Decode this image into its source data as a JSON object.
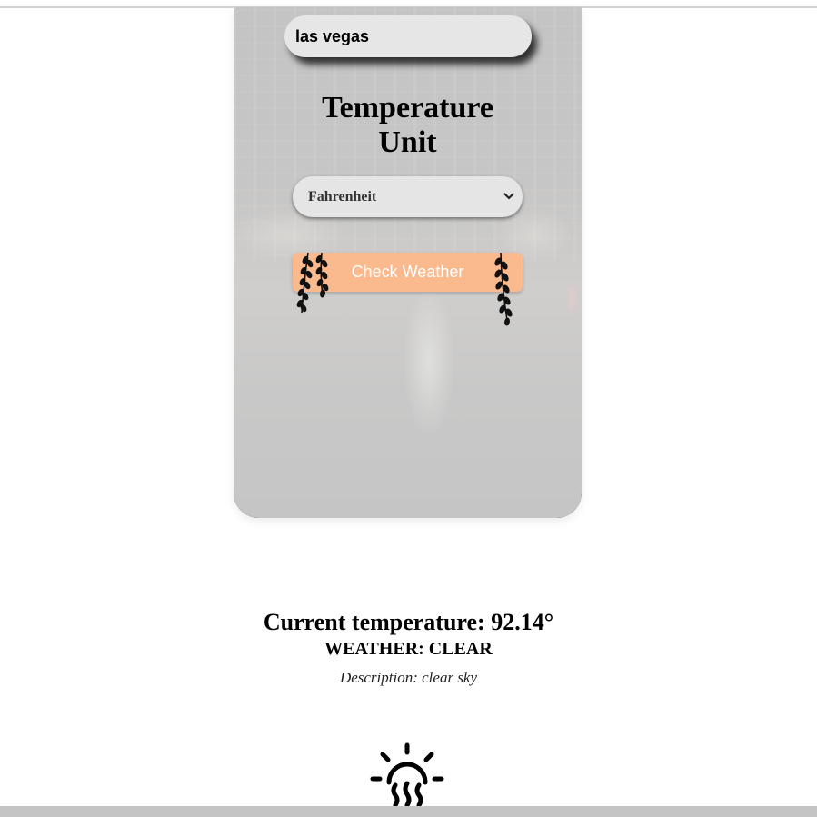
{
  "search": {
    "value": "las vegas"
  },
  "unit_section": {
    "heading_line1": "Temperature",
    "heading_line2": "Unit",
    "selected_unit": "Fahrenheit"
  },
  "actions": {
    "check_label": "Check Weather",
    "button_color": "#fbb98e"
  },
  "result": {
    "temperature_text": "Current temperature: 92.14°",
    "weather_text": "WEATHER: CLEAR",
    "description_text": "Description: clear sky",
    "icon": "sun-haze-icon"
  }
}
